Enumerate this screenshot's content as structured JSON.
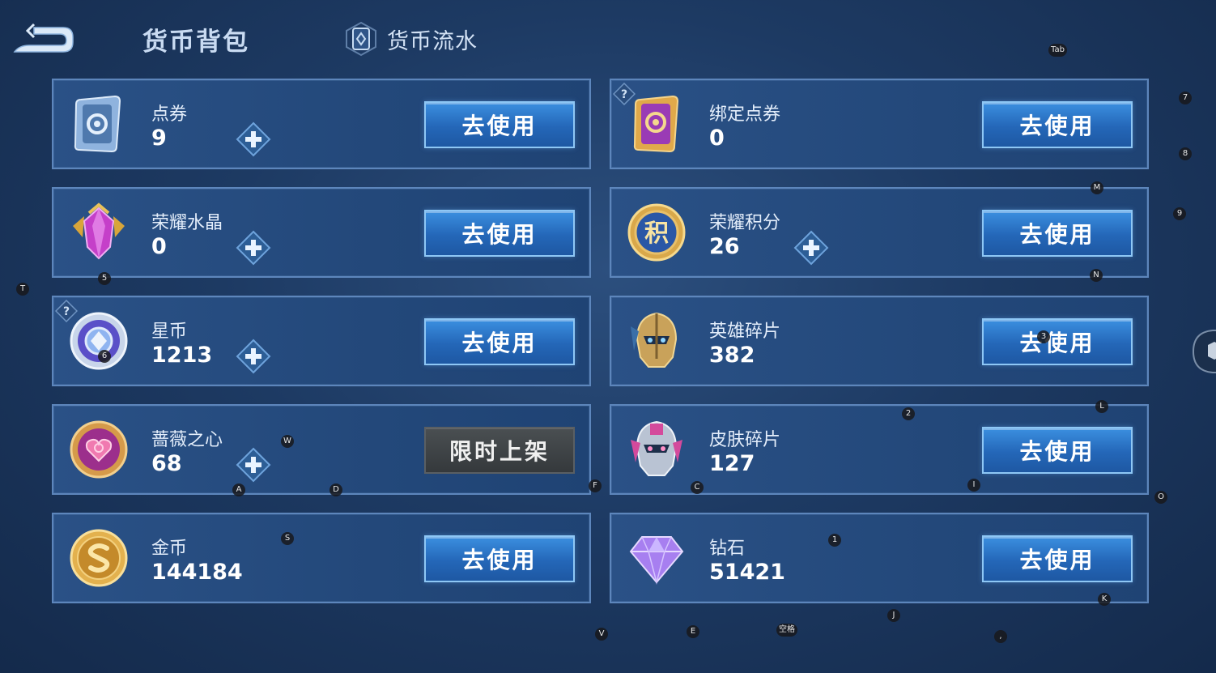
{
  "header": {
    "title": "货币背包",
    "flow_label": "货币流水"
  },
  "use_label": "去使用",
  "limited_label": "限时上架",
  "currencies": [
    {
      "name": "点券",
      "amount": "9",
      "icon": "voucher-icon"
    },
    {
      "name": "绑定点券",
      "amount": "0",
      "icon": "bound-voucher-icon"
    },
    {
      "name": "荣耀水晶",
      "amount": "0",
      "icon": "glory-crystal-icon"
    },
    {
      "name": "荣耀积分",
      "amount": "26",
      "icon": "glory-points-icon",
      "icon_text": "积"
    },
    {
      "name": "星币",
      "amount": "1213",
      "icon": "star-coin-icon"
    },
    {
      "name": "英雄碎片",
      "amount": "382",
      "icon": "hero-fragment-icon"
    },
    {
      "name": "蔷薇之心",
      "amount": "68",
      "icon": "rose-heart-icon"
    },
    {
      "name": "皮肤碎片",
      "amount": "127",
      "icon": "skin-fragment-icon"
    },
    {
      "name": "金币",
      "amount": "144184",
      "icon": "gold-coin-icon"
    },
    {
      "name": "钻石",
      "amount": "51421",
      "icon": "diamond-icon"
    }
  ],
  "key_hints": {
    "tab": "Tab",
    "k7": "7",
    "k8": "8",
    "k9": "9",
    "m": "M",
    "n": "N",
    "t": "T",
    "k5": "5",
    "k6": "6",
    "k3": "3",
    "k2": "2",
    "l": "L",
    "w": "W",
    "a": "A",
    "d": "D",
    "f": "F",
    "c": "C",
    "i": "I",
    "o": "O",
    "s": "S",
    "k1": "1",
    "j": "J",
    "k": "K",
    "v": "V",
    "e": "E",
    "space": "空格",
    "comma": ","
  },
  "colors": {
    "background": "#1d3a63",
    "card": "#23487a",
    "card_border": "#5d86bc",
    "use_button": "#2467b8",
    "disabled_button": "#3f4447"
  }
}
